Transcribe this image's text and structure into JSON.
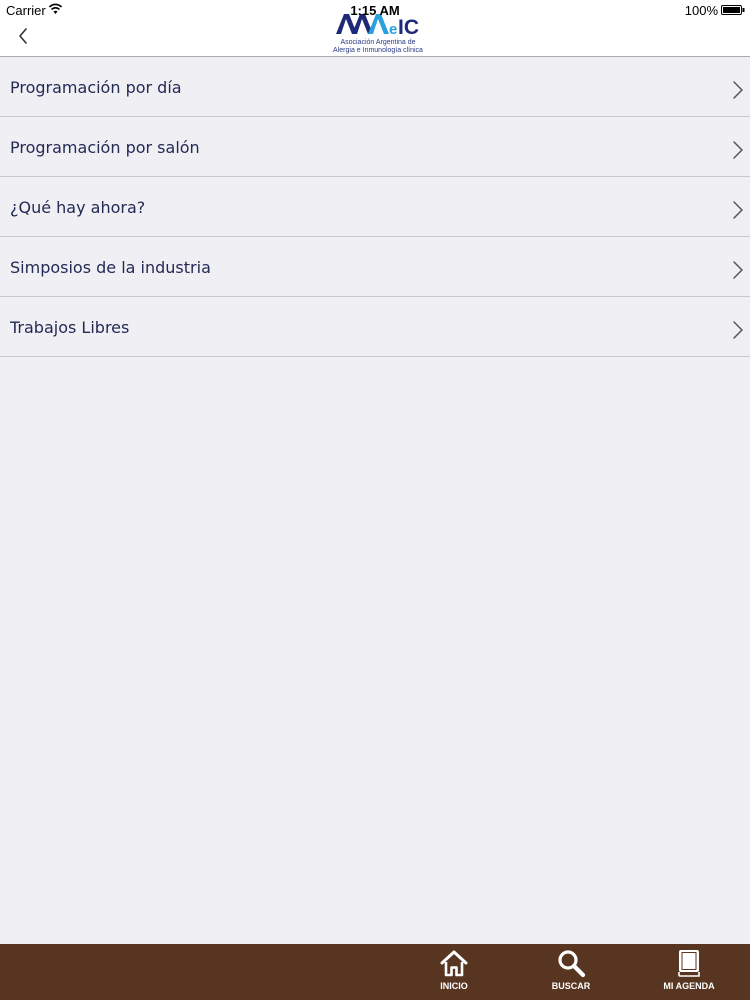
{
  "status_bar": {
    "carrier": "Carrier",
    "time": "1:15 AM",
    "battery": "100%"
  },
  "nav": {
    "back_icon": "chevron-left-icon",
    "logo": {
      "mark": "AAAeIC",
      "line1": "Asociación Argentina de",
      "line2": "Alergia e Inmunología clínica",
      "colors": {
        "dark": "#1e2a78",
        "light": "#2aa0dc"
      }
    }
  },
  "menu": {
    "items": [
      {
        "label": "Programación por día"
      },
      {
        "label": "Programación por salón"
      },
      {
        "label": "¿Qué hay ahora?"
      },
      {
        "label": "Simposios de la industria"
      },
      {
        "label": "Trabajos Libres"
      }
    ]
  },
  "tabbar": {
    "background": "#583520",
    "tabs": [
      {
        "label": "INICIO",
        "icon": "home-icon"
      },
      {
        "label": "BUSCAR",
        "icon": "search-icon"
      },
      {
        "label": "MI AGENDA",
        "icon": "book-icon"
      }
    ]
  },
  "colors": {
    "background": "#efeff4",
    "menu_text": "#232a54",
    "separator": "#c8c8cc"
  }
}
